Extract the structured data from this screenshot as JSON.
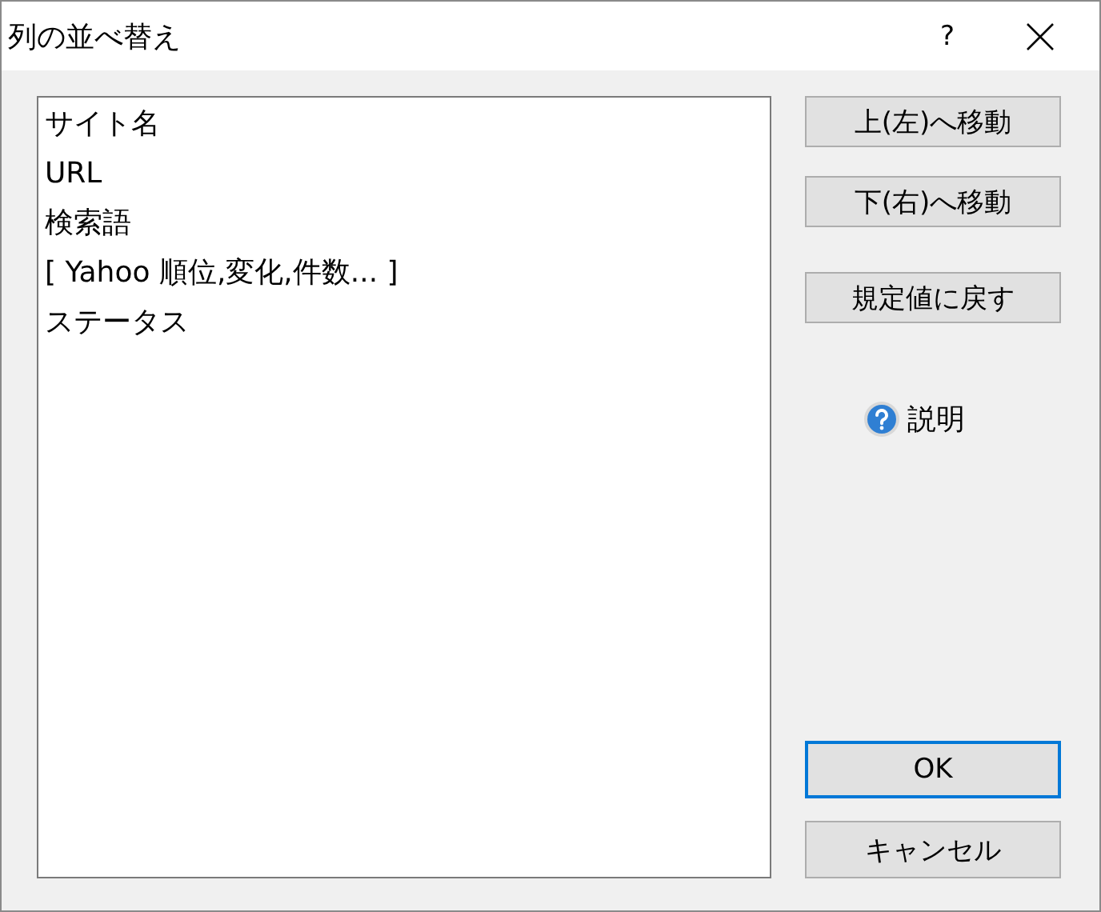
{
  "window": {
    "title": "列の並べ替え",
    "help_glyph": "?"
  },
  "columns": [
    "サイト名",
    "URL",
    "検索語",
    "[ Yahoo 順位,変化,件数... ]",
    "ステータス"
  ],
  "buttons": [
    {
      "label": "上(左)へ移動",
      "focused": false
    },
    {
      "label": "下(右)へ移動",
      "focused": false
    },
    {
      "label": "規定値に戻す",
      "focused": false
    }
  ],
  "help_link": "説明",
  "footer_buttons": [
    {
      "label": "OK",
      "focused": true
    },
    {
      "label": "キャンセル",
      "focused": false
    }
  ]
}
